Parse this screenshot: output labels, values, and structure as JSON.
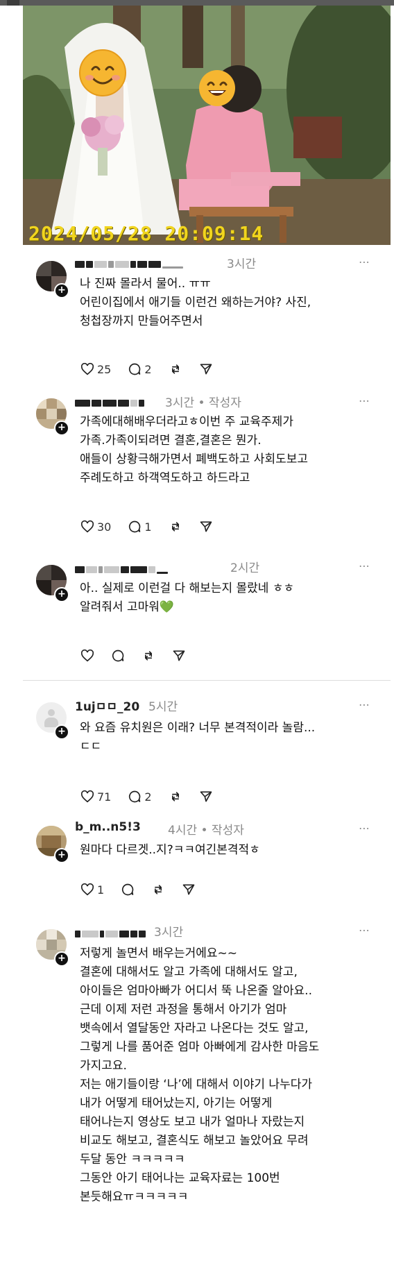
{
  "photo": {
    "timestamp": "2024/05/28  20:09:14",
    "faces": [
      "smiling-face-emoji",
      "grinning-face-emoji"
    ]
  },
  "comments": [
    {
      "time": "3시간",
      "text": "나 진짜 몰라서 물어.. ㅠㅠ\n어린이집에서 애기들 이런건 왜하는거야? 사진,\n청첩장까지 만들어주면서",
      "likes": "25",
      "replies": "2"
    },
    {
      "time": "3시간 • 작성자",
      "text": "가족에대해배우더라고ㅎ이번 주 교육주제가\n가족.가족이되려면 결혼,결혼은 뭔가.\n애들이 상황극해가면서 폐백도하고 사회도보고\n주례도하고 하객역도하고 하드라고",
      "likes": "30",
      "replies": "1"
    },
    {
      "time": "2시간",
      "text": "아.. 실제로 이런걸 다 해보는지 몰랐네 ㅎㅎ\n알려줘서 고마워",
      "emoji": "💚",
      "likes": "",
      "replies": ""
    },
    {
      "username": "1ujㅁㅁ_20",
      "time": "5시간",
      "text": "와 요즘 유치원은 이래? 너무 본격적이라 놀람...\nㄷㄷ",
      "likes": "71",
      "replies": "2"
    },
    {
      "username": "b_m..n5!3",
      "time": "4시간 • 작성자",
      "text": "원마다 다르겟..지?ㅋㅋ여긴본격적ㅎ",
      "likes": "1",
      "replies": ""
    },
    {
      "username": "ㅁ",
      "time": "3시간",
      "text": "저렇게 놀면서 배우는거에요~~\n결혼에 대해서도 알고 가족에 대해서도 알고,\n아이들은 엄마아빠가 어디서 뚝 나온줄 알아요..\n근데 이제 저런 과정을 통해서 아기가 엄마\n뱃속에서 열달동안 자라고 나온다는 것도 알고,\n그렇게 나를 품어준 엄마 아빠에게 감사한 마음도\n가지고요.\n저는 애기들이랑 ‘나’에 대해서 이야기 나누다가\n내가 어떻게 태어났는지, 아기는 어떻게\n태어나는지 영상도 보고 내가 얼마나 자랐는지\n비교도 해보고, 결혼식도 해보고 놀았어요 무려\n두달 동안 ㅋㅋㅋㅋㅋ\n그동안 아기 태어나는 교육자료는 100번\n본듯해요ㅠㅋㅋㅋㅋㅋ"
    }
  ],
  "icons": {
    "more": "⋯",
    "plus": "+"
  }
}
